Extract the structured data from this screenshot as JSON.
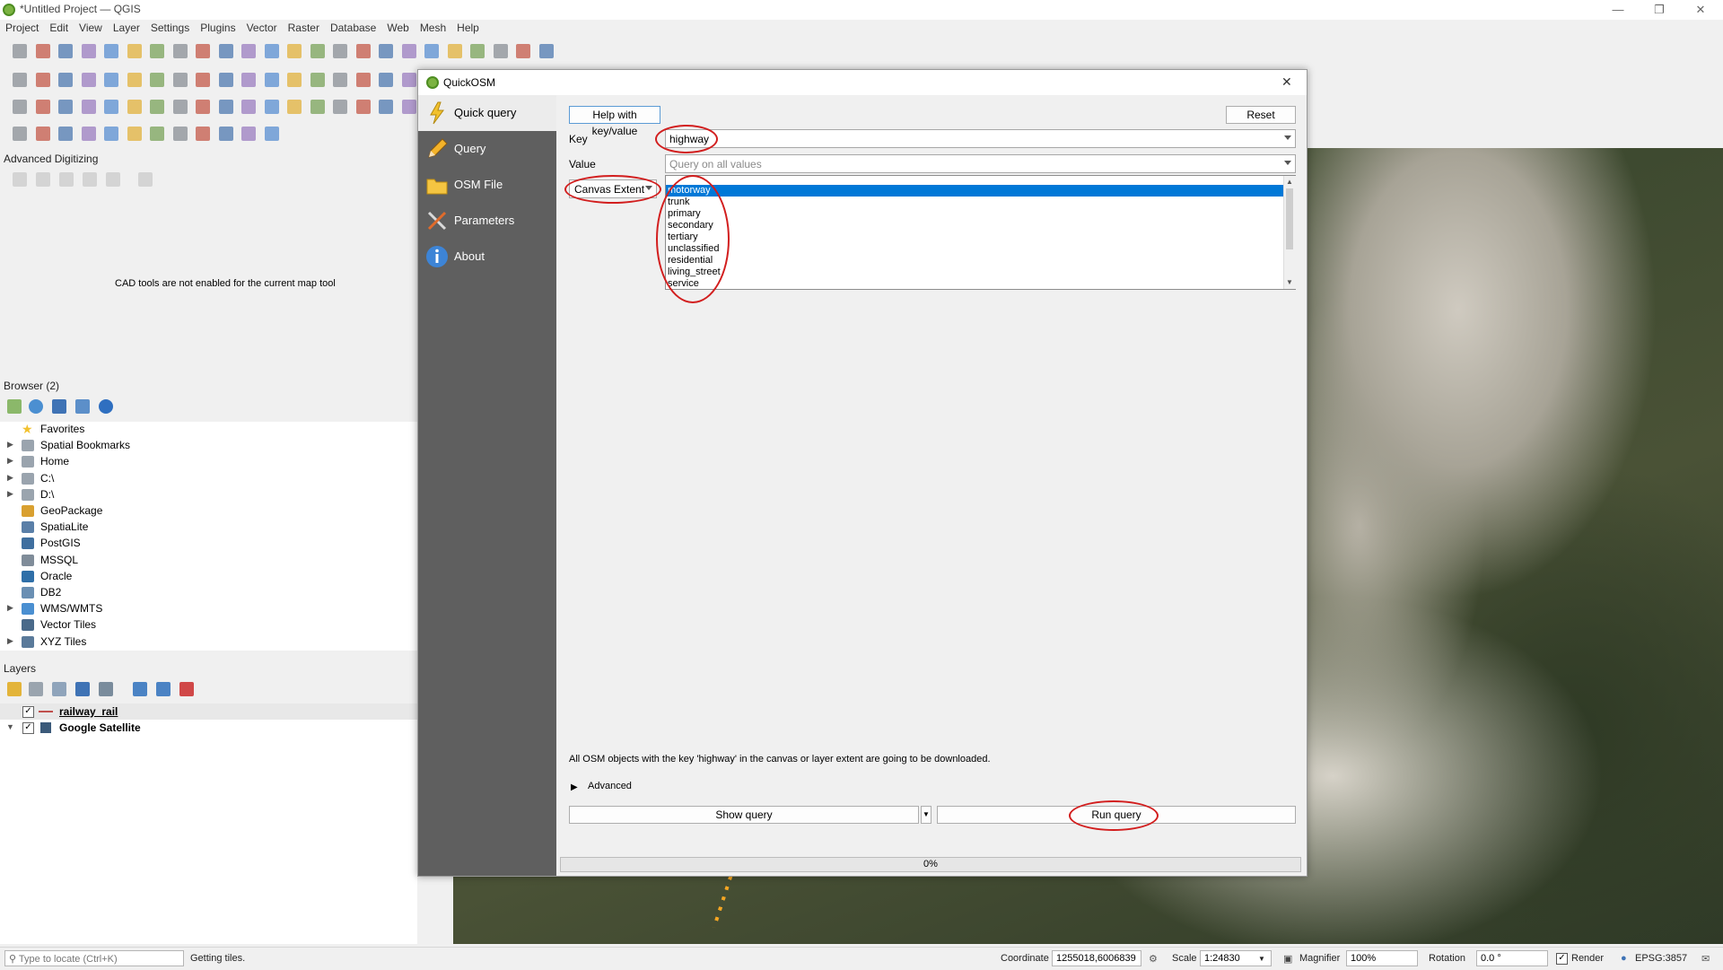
{
  "window": {
    "title": "*Untitled Project — QGIS"
  },
  "menu": [
    "Project",
    "Edit",
    "View",
    "Layer",
    "Settings",
    "Plugins",
    "Vector",
    "Raster",
    "Database",
    "Web",
    "Mesh",
    "Help"
  ],
  "advanced_digitizing": {
    "title": "Advanced Digitizing",
    "message": "CAD tools are not enabled for the current map tool"
  },
  "browser": {
    "title": "Browser (2)",
    "items": [
      {
        "label": "Favorites",
        "expandable": false,
        "icon": "star-icon"
      },
      {
        "label": "Spatial Bookmarks",
        "expandable": true,
        "icon": "bookmark-icon"
      },
      {
        "label": "Home",
        "expandable": true,
        "icon": "home-folder-icon"
      },
      {
        "label": "C:\\",
        "expandable": true,
        "icon": "drive-icon"
      },
      {
        "label": "D:\\",
        "expandable": true,
        "icon": "drive-icon"
      },
      {
        "label": "GeoPackage",
        "expandable": false,
        "icon": "geopackage-icon"
      },
      {
        "label": "SpatiaLite",
        "expandable": false,
        "icon": "spatialite-icon"
      },
      {
        "label": "PostGIS",
        "expandable": false,
        "icon": "postgis-icon"
      },
      {
        "label": "MSSQL",
        "expandable": false,
        "icon": "mssql-icon"
      },
      {
        "label": "Oracle",
        "expandable": false,
        "icon": "oracle-icon"
      },
      {
        "label": "DB2",
        "expandable": false,
        "icon": "db2-icon"
      },
      {
        "label": "WMS/WMTS",
        "expandable": true,
        "icon": "globe-icon"
      },
      {
        "label": "Vector Tiles",
        "expandable": false,
        "icon": "vector-tiles-icon"
      },
      {
        "label": "XYZ Tiles",
        "expandable": true,
        "icon": "xyz-tiles-icon"
      }
    ]
  },
  "layers": {
    "title": "Layers",
    "items": [
      {
        "label": "railway_rail",
        "checked": true
      },
      {
        "label": "Google Satellite",
        "checked": true
      }
    ]
  },
  "dialog": {
    "title": "QuickOSM",
    "close": "✕",
    "sidebar": [
      {
        "label": "Quick query",
        "icon": "lightning-icon"
      },
      {
        "label": "Query",
        "icon": "pencil-icon"
      },
      {
        "label": "OSM File",
        "icon": "folder-icon"
      },
      {
        "label": "Parameters",
        "icon": "tools-icon"
      },
      {
        "label": "About",
        "icon": "info-icon"
      }
    ],
    "help_button": "Help with key/value",
    "reset_button": "Reset",
    "key_label": "Key",
    "key_value": "highway",
    "value_label": "Value",
    "value_placeholder": "Query on all values",
    "extent_value": "Canvas Extent",
    "value_options": [
      "motorway",
      "trunk",
      "primary",
      "secondary",
      "tertiary",
      "unclassified",
      "residential",
      "living_street",
      "service"
    ],
    "selected_option": "motorway",
    "description": "All OSM objects with the key 'highway' in the canvas or layer extent are going to be downloaded.",
    "advanced_label": "Advanced",
    "show_query_button": "Show query",
    "run_query_button": "Run query",
    "progress_text": "0%",
    "progress": 0
  },
  "statusbar": {
    "locate_placeholder": "Type to locate (Ctrl+K)",
    "message": "Getting tiles.",
    "coordinate_label": "Coordinate",
    "coordinate_value": "1255018,6006839",
    "scale_label": "Scale",
    "scale_value": "1:24830",
    "magnifier_label": "Magnifier",
    "magnifier_value": "100%",
    "rotation_label": "Rotation",
    "rotation_value": "0.0 °",
    "render_label": "Render",
    "crs": "EPSG:3857"
  },
  "colors": {
    "accent": "#0078d7",
    "annotation": "#d21e1e",
    "sidebar": "#5f5f5f"
  }
}
